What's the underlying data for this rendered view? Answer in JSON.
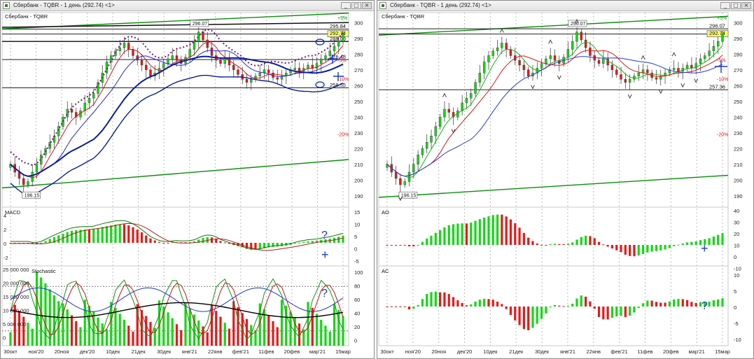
{
  "windows": [
    {
      "title": "Сбербанк - TQBR - 1 день (292.74) <1>",
      "buttons": [
        "_",
        "□",
        "×"
      ]
    },
    {
      "title": "Сбербанк - TQBR - 1 день (292.74) <1>",
      "buttons": [
        "_",
        "□",
        "×"
      ]
    }
  ],
  "chart_data": [
    {
      "type": "candlestick",
      "panel": "price",
      "title": "Сбербанк - TQBR",
      "ylim": [
        185,
        305
      ],
      "y_ticks": [
        190,
        200,
        210,
        220,
        230,
        240,
        250,
        260,
        270,
        280,
        290,
        300
      ],
      "x_tick_labels": [
        "30окт",
        "ноя'20",
        "20ноя",
        "дек'20",
        "10дек",
        "21дек",
        "30дек",
        "янв'21",
        "22янв",
        "фев'21",
        "11фев",
        "20фев",
        "мар'21",
        "15мар"
      ],
      "price_labels": [
        "295.84",
        "292.74",
        "288.00",
        "276.48",
        "258.55"
      ],
      "percent_labels": [
        "+5%",
        "-5%",
        "-10%",
        "-20%"
      ],
      "annotations": [
        "196.15",
        "296.07"
      ],
      "last_price": 292.74,
      "closes": [
        210,
        205,
        201,
        197,
        199,
        205,
        210,
        216,
        220,
        224,
        228,
        234,
        240,
        245,
        243,
        240,
        244,
        249,
        252,
        255,
        262,
        268,
        275,
        279,
        282,
        284,
        287,
        283,
        279,
        276,
        273,
        270,
        266,
        268,
        271,
        274,
        277,
        279,
        276,
        274,
        278,
        283,
        288,
        294,
        289,
        284,
        279,
        276,
        274,
        277,
        273,
        270,
        267,
        264,
        262,
        264,
        266,
        268,
        270,
        268,
        265,
        264,
        266,
        268,
        270,
        271,
        269,
        271,
        273,
        271,
        274,
        277,
        279,
        282,
        285,
        288,
        292.74
      ]
    },
    {
      "type": "macd",
      "panel": "indicator",
      "title": "MACD",
      "left_ticks": [
        "4",
        "2",
        "0",
        "-2"
      ],
      "right_ticks": [
        "15",
        "10",
        "5",
        "0",
        "-5"
      ],
      "annotations": [
        "?",
        "+"
      ]
    },
    {
      "type": "stochastic",
      "panel": "indicator",
      "title": "Stochastic",
      "left_ticks": [
        "25 000 000",
        "20 000 000",
        "15 000 000",
        "10 000 000",
        "5 000 000",
        "0"
      ],
      "right_ticks": [
        "100",
        "80",
        "60",
        "40",
        "20",
        "0"
      ],
      "annotations": [
        "?"
      ]
    },
    {
      "type": "candlestick",
      "panel": "price",
      "title": "Сбербанк - TQBR",
      "ylim": [
        185,
        305
      ],
      "y_ticks": [
        190,
        200,
        210,
        220,
        230,
        240,
        250,
        260,
        270,
        280,
        290,
        300
      ],
      "x_tick_labels": [
        "30окт",
        "ноя'20",
        "20ноя",
        "дек'20",
        "10дек",
        "21дек",
        "30дек",
        "янв'21",
        "22янв",
        "фев'21",
        "11фев",
        "20фев",
        "мар'21",
        "15мар"
      ],
      "price_labels": [
        "296.07",
        "292.74",
        "257.36"
      ],
      "percent_labels": [
        "+5%",
        "-5%",
        "-10%",
        "-20%"
      ],
      "annotations": [
        "196.15",
        "296.07",
        "+"
      ],
      "last_price": 292.74
    },
    {
      "type": "bar",
      "panel": "indicator",
      "title": "AO",
      "right_ticks": [
        "40",
        "30",
        "20",
        "10",
        "0",
        "-10"
      ],
      "annotations": [
        "+"
      ]
    },
    {
      "type": "bar",
      "panel": "indicator",
      "title": "AC",
      "right_ticks": [
        "10",
        "5",
        "0",
        "-5",
        "-10"
      ],
      "annotations": [
        "?"
      ]
    }
  ]
}
